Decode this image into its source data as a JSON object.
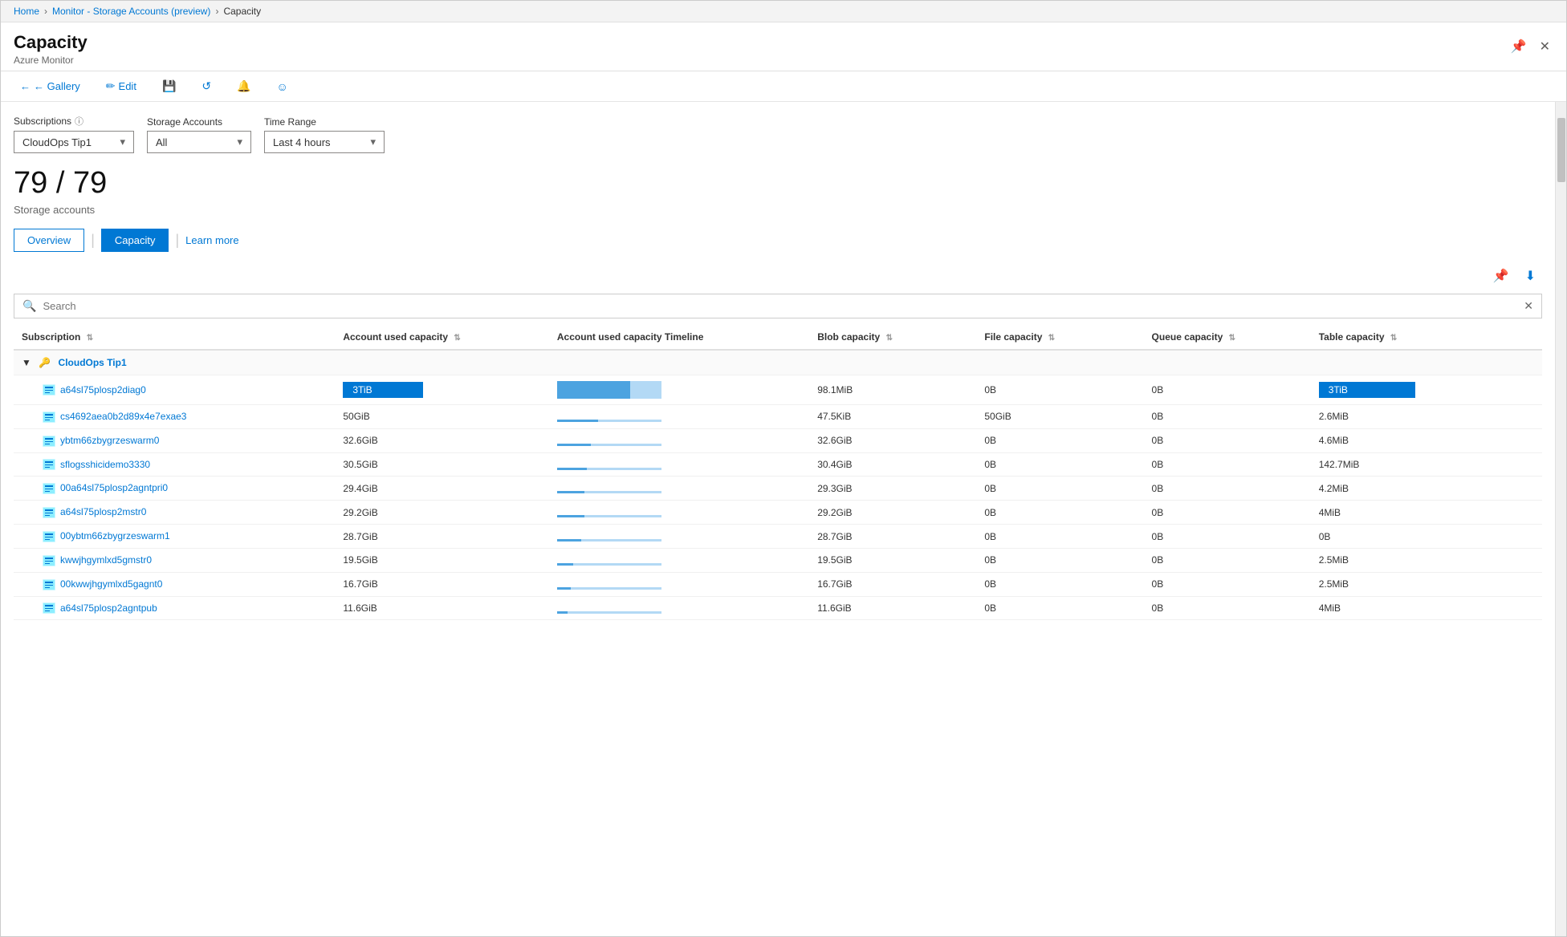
{
  "breadcrumb": {
    "items": [
      "Home",
      "Monitor - Storage Accounts (preview)",
      "Capacity"
    ]
  },
  "header": {
    "title": "Capacity",
    "subtitle": "Azure Monitor",
    "pin_label": "📌",
    "close_label": "✕"
  },
  "toolbar": {
    "back_label": "← Gallery",
    "edit_label": "Edit",
    "save_label": "💾",
    "refresh_label": "↺",
    "alert_label": "🔔",
    "smiley_label": "☺"
  },
  "filters": {
    "subscriptions_label": "Subscriptions",
    "subscriptions_value": "CloudOps Tip1",
    "storage_accounts_label": "Storage Accounts",
    "storage_accounts_value": "All",
    "time_range_label": "Time Range",
    "time_range_value": "Last 4 hours"
  },
  "count": {
    "value": "79 / 79",
    "label": "Storage accounts"
  },
  "tabs": {
    "overview_label": "Overview",
    "capacity_label": "Capacity",
    "learn_more_label": "Learn more"
  },
  "search": {
    "placeholder": "Search"
  },
  "table": {
    "columns": [
      "Subscription",
      "Account used capacity",
      "Account used capacity Timeline",
      "Blob capacity",
      "File capacity",
      "Queue capacity",
      "Table capacity"
    ],
    "group": {
      "name": "CloudOps Tip1",
      "rows": [
        {
          "name": "a64sl75plosp2diag0",
          "used_cap": "3TiB",
          "blob": "98.1MiB",
          "file": "0B",
          "queue": "0B",
          "table": "3TiB",
          "bar_pct": 95,
          "timeline_pct": 60,
          "highlight_cap": true,
          "highlight_table": true
        },
        {
          "name": "cs4692aea0b2d89x4e7exae3",
          "used_cap": "50GiB",
          "blob": "47.5KiB",
          "file": "50GiB",
          "queue": "0B",
          "table": "2.6MiB",
          "bar_pct": 0,
          "timeline_pct": 30,
          "highlight_cap": false,
          "highlight_table": false
        },
        {
          "name": "ybtm66zbygrzeswarm0",
          "used_cap": "32.6GiB",
          "blob": "32.6GiB",
          "file": "0B",
          "queue": "0B",
          "table": "4.6MiB",
          "bar_pct": 0,
          "timeline_pct": 25,
          "highlight_cap": false,
          "highlight_table": false
        },
        {
          "name": "sflogsshicidemo3330",
          "used_cap": "30.5GiB",
          "blob": "30.4GiB",
          "file": "0B",
          "queue": "0B",
          "table": "142.7MiB",
          "bar_pct": 0,
          "timeline_pct": 22,
          "highlight_cap": false,
          "highlight_table": false
        },
        {
          "name": "00a64sl75plosp2agntpri0",
          "used_cap": "29.4GiB",
          "blob": "29.3GiB",
          "file": "0B",
          "queue": "0B",
          "table": "4.2MiB",
          "bar_pct": 0,
          "timeline_pct": 20,
          "highlight_cap": false,
          "highlight_table": false
        },
        {
          "name": "a64sl75plosp2mstr0",
          "used_cap": "29.2GiB",
          "blob": "29.2GiB",
          "file": "0B",
          "queue": "0B",
          "table": "4MiB",
          "bar_pct": 0,
          "timeline_pct": 20,
          "highlight_cap": false,
          "highlight_table": false
        },
        {
          "name": "00ybtm66zbygrzeswarm1",
          "used_cap": "28.7GiB",
          "blob": "28.7GiB",
          "file": "0B",
          "queue": "0B",
          "table": "0B",
          "bar_pct": 0,
          "timeline_pct": 18,
          "highlight_cap": false,
          "highlight_table": false
        },
        {
          "name": "kwwjhgymlxd5gmstr0",
          "used_cap": "19.5GiB",
          "blob": "19.5GiB",
          "file": "0B",
          "queue": "0B",
          "table": "2.5MiB",
          "bar_pct": 0,
          "timeline_pct": 12,
          "highlight_cap": false,
          "highlight_table": false
        },
        {
          "name": "00kwwjhgymlxd5gagnt0",
          "used_cap": "16.7GiB",
          "blob": "16.7GiB",
          "file": "0B",
          "queue": "0B",
          "table": "2.5MiB",
          "bar_pct": 0,
          "timeline_pct": 10,
          "highlight_cap": false,
          "highlight_table": false
        },
        {
          "name": "a64sl75plosp2agntpub",
          "used_cap": "11.6GiB",
          "blob": "11.6GiB",
          "file": "0B",
          "queue": "0B",
          "table": "4MiB",
          "bar_pct": 0,
          "timeline_pct": 8,
          "highlight_cap": false,
          "highlight_table": false
        }
      ]
    }
  }
}
